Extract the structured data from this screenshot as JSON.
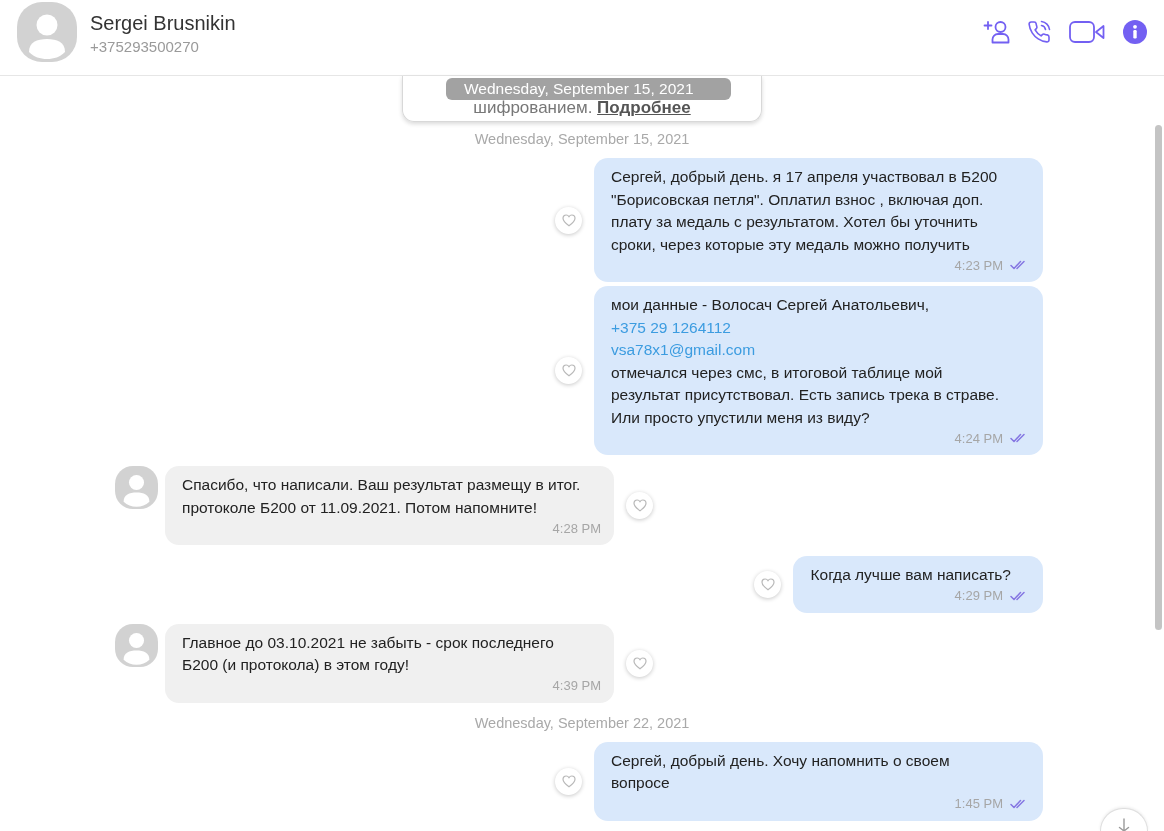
{
  "header": {
    "name": "Sergei Brusnikin",
    "phone": "+375293500270"
  },
  "notice": {
    "text": "шифрованием.",
    "link": "Подробнее"
  },
  "sticky_date": "Wednesday, September 15, 2021",
  "timeline": [
    {
      "kind": "date",
      "text": "Wednesday, September 15, 2021"
    },
    {
      "kind": "outgoing",
      "text": "Сергей, добрый день. я 17 апреля участвовал в Б200 \"Борисовская петля\". Оплатил взнос , включая доп. плату за медаль с результатом. Хотел бы уточнить сроки, через которые эту медаль можно получить",
      "time": "4:23 PM",
      "read": true
    },
    {
      "kind": "outgoing",
      "lines": [
        [
          {
            "kind": "text",
            "text": "мои данные - Волосач Сергей Анатольевич, "
          },
          {
            "kind": "link",
            "text": "+375 29 1264112"
          }
        ],
        [
          {
            "kind": "link",
            "text": "vsa78x1@gmail.com"
          }
        ],
        [
          {
            "kind": "text",
            "text": "отмечался через смс, в итоговой таблице мой результат присутствовал. Есть запись трека в страве. Или просто упустили меня из виду?"
          }
        ]
      ],
      "time": "4:24 PM",
      "read": true
    },
    {
      "kind": "incoming",
      "text": "Спасибо, что написали. Ваш результат размещу в итог. протоколе Б200 от 11.09.2021. Потом напомните!",
      "time": "4:28 PM"
    },
    {
      "kind": "outgoing",
      "text": "Когда лучше вам написать?",
      "time": "4:29 PM",
      "read": true
    },
    {
      "kind": "incoming",
      "text": "Главное до 03.10.2021 не забыть - срок последнего Б200 (и протокола) в этом году!",
      "time": "4:39 PM"
    },
    {
      "kind": "date",
      "text": "Wednesday, September 22, 2021"
    },
    {
      "kind": "outgoing",
      "text": "Сергей, добрый день. Хочу напомнить о своем вопросе",
      "time": "1:45 PM",
      "read": true
    }
  ]
}
